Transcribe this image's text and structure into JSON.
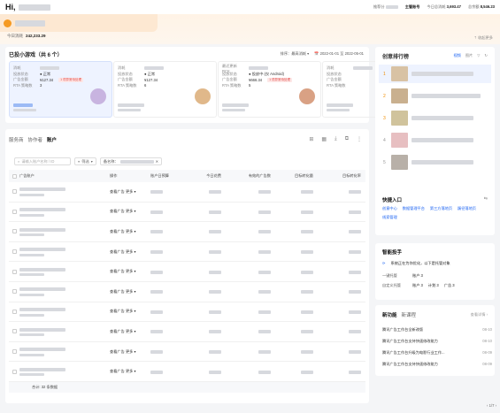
{
  "topbar": {
    "greeting": "Hi,",
    "stats": [
      {
        "label": "推荐分",
        "value": ""
      },
      {
        "label": "",
        "value": "主管账号"
      },
      {
        "label": "今日总消耗",
        "value": "3,693.47"
      },
      {
        "label": "总余额",
        "value": "8,546.23"
      }
    ]
  },
  "account": {
    "spend_label": "今日消耗",
    "spend_value": "242,233.29",
    "collapse": "收起更多"
  },
  "games": {
    "title": "已投小游戏（共 6 个）",
    "sort_label": "排序：",
    "sort_value": "最高消耗",
    "date_range": "2022-01-01 至 2022-05-01",
    "cards": [
      {
        "rows": [
          [
            "消耗",
            ""
          ],
          [
            "投放状态",
            "正常"
          ],
          [
            "广告金额",
            "¥127.34"
          ],
          [
            "RTA 策略数",
            "3"
          ]
        ],
        "tag": "1 项异常待处理",
        "avatar_color": "#c8b4e0"
      },
      {
        "rows": [
          [
            "消耗",
            ""
          ],
          [
            "投放状态",
            "正常"
          ],
          [
            "广告金额",
            "¥127.34"
          ],
          [
            "RTA 策略数",
            "6"
          ]
        ],
        "tag": "",
        "avatar_color": "#e0b88a"
      },
      {
        "rows": [
          [
            "最近更新 RCK",
            ""
          ],
          [
            "投放状态",
            "投放中 (仅 Android)"
          ],
          [
            "广告金额",
            "¥666.34"
          ],
          [
            "RTA 策略数",
            "5"
          ]
        ],
        "tag": "1 项异常待处理",
        "avatar_color": "#d9a184"
      },
      {
        "rows": [
          [
            "消耗",
            ""
          ],
          [
            "投放状态",
            ""
          ],
          [
            "广告金额",
            ""
          ],
          [
            "RTA 策略数",
            ""
          ]
        ],
        "tag": "",
        "avatar_color": "#ddd"
      }
    ]
  },
  "table": {
    "tabs": [
      "服务商",
      "协作者",
      "账户"
    ],
    "search_placeholder": "请输入账户名称 / ID",
    "filter_label": "筛选",
    "chip_label": "备名称：",
    "columns": [
      "广告账户",
      "操作",
      "账户日预算",
      "今日花费",
      "有效的广告数",
      "目标转化量",
      "目标转化率"
    ],
    "action_text": "查看广告",
    "more_text": "更多",
    "row_count": 10,
    "total_label": "合计: 32 条数据",
    "pager": "1/7"
  },
  "rank": {
    "title": "创意排行榜",
    "tabs": [
      "视频",
      "图片"
    ],
    "items": [
      "1",
      "2",
      "3",
      "4",
      "5"
    ],
    "thumb_colors": [
      "#d8c2a4",
      "#c9b08f",
      "#d0c39c",
      "#e7bfc1",
      "#b8b0a8"
    ]
  },
  "quick": {
    "title": "快捷入口",
    "links": [
      "创意中心",
      "数据管理平台",
      "第三方落地页",
      "蹊径落地页",
      "线索管理"
    ]
  },
  "smart": {
    "title": "智能投手",
    "status": "系统正在为你优化，以下是托管对象",
    "lines": [
      {
        "k": "一键托管",
        "items": [
          "账户 3"
        ]
      },
      {
        "k": "自定义托管",
        "items": [
          "账户 3",
          "计划 3",
          "广告 3"
        ]
      }
    ]
  },
  "news": {
    "tabs": [
      "新功能",
      "新课程"
    ],
    "more": "查看详情",
    "items": [
      {
        "t": "腾讯广告工作台全新改版",
        "d": "08-10"
      },
      {
        "t": "腾讯广告工作台支持快速修改能力",
        "d": "08-10"
      },
      {
        "t": "腾讯广告工作台升级为电影行业工作...",
        "d": "08-09"
      },
      {
        "t": "腾讯广告工作台支持快速修改能力",
        "d": "08-09"
      }
    ]
  }
}
